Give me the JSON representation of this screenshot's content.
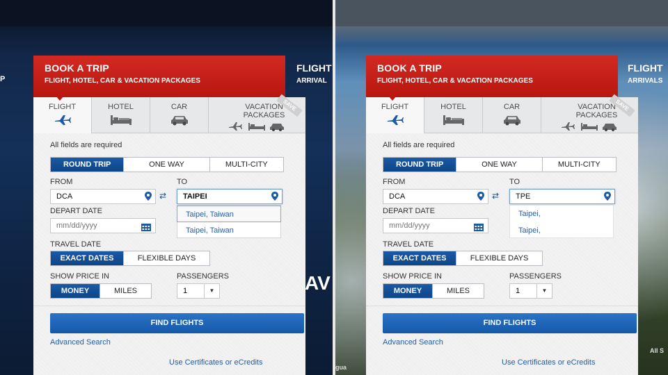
{
  "panels": [
    {
      "nav": {
        "left_fragment": "P",
        "right_title": "FLIGHT",
        "right_sub": "ARRIVAL"
      },
      "background_text": "AV",
      "footer_fragment": "",
      "booking": {
        "title": "BOOK A TRIP",
        "subtitle": "FLIGHT, HOTEL, CAR & VACATION PACKAGES",
        "tabs": [
          {
            "label": "FLIGHT",
            "icon": "plane-icon",
            "active": true
          },
          {
            "label": "HOTEL",
            "icon": "bed-icon",
            "active": false
          },
          {
            "label": "CAR",
            "icon": "car-icon",
            "active": false
          },
          {
            "label": "VACATION PACKAGES",
            "icon": "vacation-icons",
            "active": false
          }
        ],
        "save_ribbon": "SAVE",
        "required_note": "All fields are required",
        "trip_types": [
          "ROUND TRIP",
          "ONE WAY",
          "MULTI-CITY"
        ],
        "trip_selected": "ROUND TRIP",
        "from_label": "FROM",
        "from_value": "DCA",
        "to_label": "TO",
        "to_value": "TAIPEI",
        "suggestions": [
          "Taipei, Taiwan",
          "Taipei, Taiwan"
        ],
        "depart_label": "DEPART DATE",
        "depart_placeholder": "mm/dd/yyyy",
        "travel_date_label": "TRAVEL DATE",
        "travel_date_options": [
          "EXACT DATES",
          "FLEXIBLE DAYS"
        ],
        "price_label": "SHOW PRICE IN",
        "price_options": [
          "MONEY",
          "MILES"
        ],
        "passengers_label": "PASSENGERS",
        "passengers_value": "1",
        "find_button": "FIND FLIGHTS",
        "advanced_search": "Advanced Search",
        "certificates": "Use Certificates or eCredits"
      }
    },
    {
      "nav": {
        "left_fragment": "",
        "right_title": "FLIGHT",
        "right_sub": "ARRIVALS"
      },
      "background_text": "",
      "footer_fragment": "gua",
      "footer_fragment_right": "All S",
      "booking": {
        "title": "BOOK A TRIP",
        "subtitle": "FLIGHT, HOTEL, CAR & VACATION PACKAGES",
        "tabs": [
          {
            "label": "FLIGHT",
            "icon": "plane-icon",
            "active": true
          },
          {
            "label": "HOTEL",
            "icon": "bed-icon",
            "active": false
          },
          {
            "label": "CAR",
            "icon": "car-icon",
            "active": false
          },
          {
            "label": "VACATION PACKAGES",
            "icon": "vacation-icons",
            "active": false
          }
        ],
        "save_ribbon": "SAVE",
        "required_note": "All fields are required",
        "trip_types": [
          "ROUND TRIP",
          "ONE WAY",
          "MULTI-CITY"
        ],
        "trip_selected": "ROUND TRIP",
        "from_label": "FROM",
        "from_value": "DCA",
        "to_label": "TO",
        "to_value": "TPE",
        "suggestions": [
          "Taipei,",
          "Taipei,"
        ],
        "depart_label": "DEPART DATE",
        "depart_placeholder": "mm/dd/yyyy",
        "travel_date_label": "TRAVEL DATE",
        "travel_date_options": [
          "EXACT DATES",
          "FLEXIBLE DAYS"
        ],
        "price_label": "SHOW PRICE IN",
        "price_options": [
          "MONEY",
          "MILES"
        ],
        "passengers_label": "PASSENGERS",
        "passengers_value": "1",
        "find_button": "FIND FLIGHTS",
        "advanced_search": "Advanced Search",
        "certificates": "Use Certificates or eCredits"
      }
    }
  ],
  "colors": {
    "brand_red": "#c0150f",
    "selected_blue": "#0e4687",
    "button_blue": "#1f66b8",
    "link_blue": "#1f5fa8"
  }
}
